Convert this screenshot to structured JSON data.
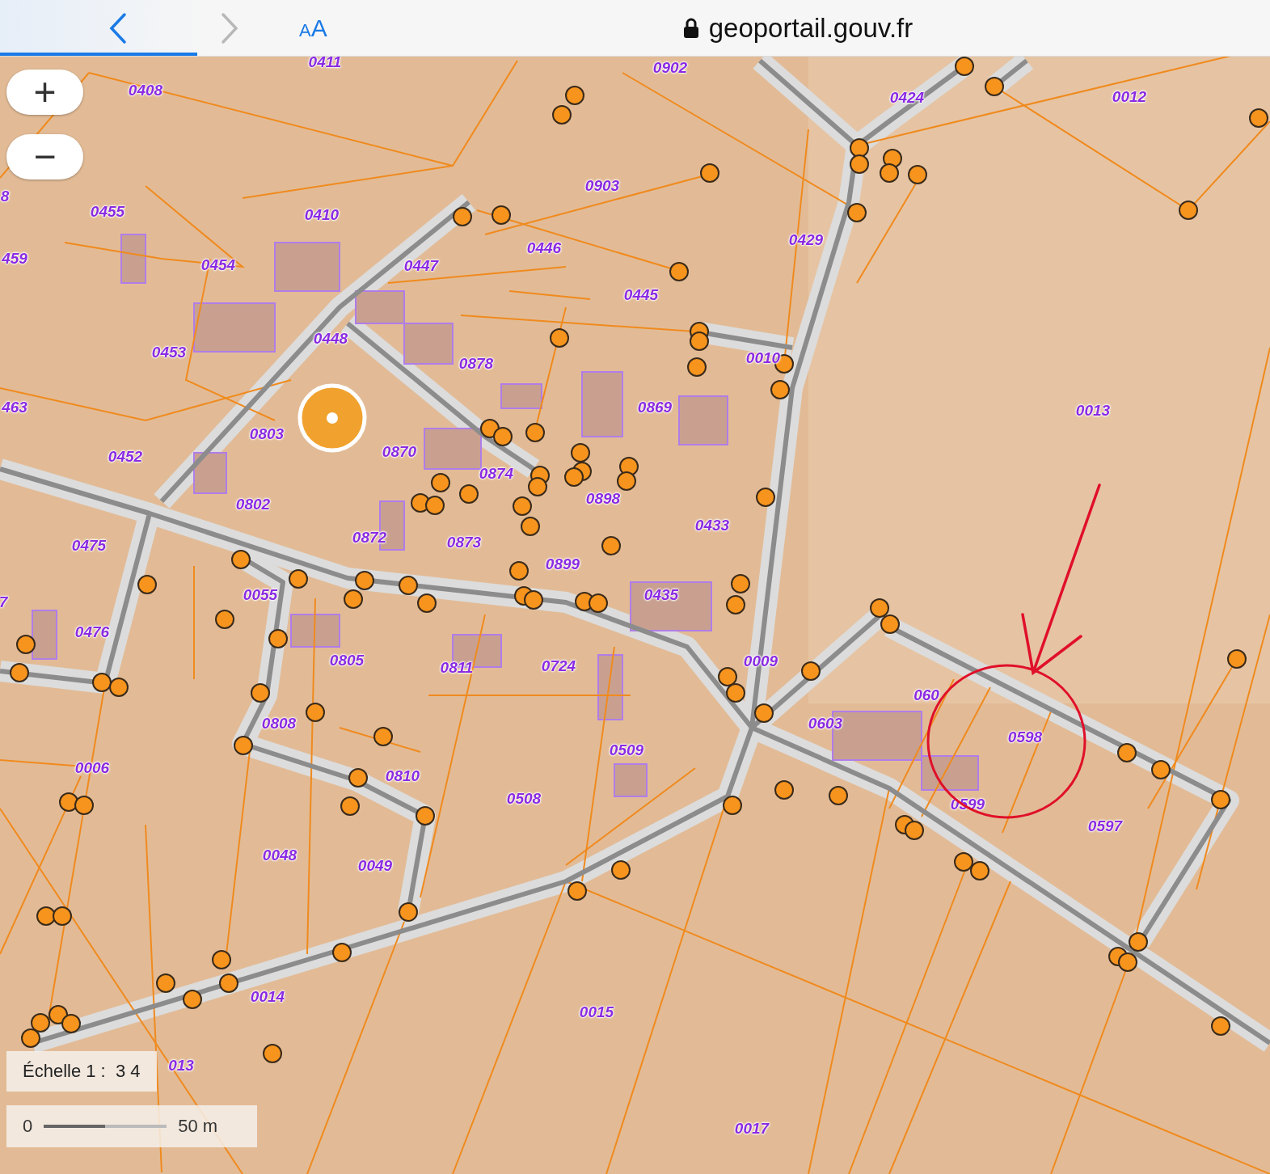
{
  "browser": {
    "back": {
      "disabled": false
    },
    "forward": {
      "disabled": true
    },
    "text_size": {
      "small": "A",
      "large": "A"
    },
    "url": "geoportail.gouv.fr",
    "load_progress": {
      "level": 0.155
    }
  },
  "map": {
    "zoom_in": "+",
    "zoom_out": "−",
    "parcels": [
      {
        "label": "0411"
      },
      {
        "label": "0902"
      },
      {
        "label": "0408"
      },
      {
        "label": "0424"
      },
      {
        "label": "0012"
      },
      {
        "label": "8"
      },
      {
        "label": "0903"
      },
      {
        "label": "0455"
      },
      {
        "label": "0410"
      },
      {
        "label": "459"
      },
      {
        "label": "0429"
      },
      {
        "label": "0446"
      },
      {
        "label": "0454"
      },
      {
        "label": "0447"
      },
      {
        "label": "0445"
      },
      {
        "label": "0448"
      },
      {
        "label": "0453"
      },
      {
        "label": "0878"
      },
      {
        "label": "0010"
      },
      {
        "label": "463"
      },
      {
        "label": "0869"
      },
      {
        "label": "0013"
      },
      {
        "label": "0803"
      },
      {
        "label": "0870"
      },
      {
        "label": "0452"
      },
      {
        "label": "0874"
      },
      {
        "label": "0802"
      },
      {
        "label": "0898"
      },
      {
        "label": "0433"
      },
      {
        "label": "0475"
      },
      {
        "label": "0872"
      },
      {
        "label": "0873"
      },
      {
        "label": "0899"
      },
      {
        "label": "0055"
      },
      {
        "label": "0435"
      },
      {
        "label": "7"
      },
      {
        "label": "0476"
      },
      {
        "label": "0805"
      },
      {
        "label": "0811"
      },
      {
        "label": "0724"
      },
      {
        "label": "0009"
      },
      {
        "label": "060"
      },
      {
        "label": "0808"
      },
      {
        "label": "0603"
      },
      {
        "label": "0598"
      },
      {
        "label": "0509"
      },
      {
        "label": "0006"
      },
      {
        "label": "0810"
      },
      {
        "label": "0508"
      },
      {
        "label": "0599"
      },
      {
        "label": "0597"
      },
      {
        "label": "0048"
      },
      {
        "label": "0049"
      },
      {
        "label": "0014"
      },
      {
        "label": "0015"
      },
      {
        "label": "013"
      },
      {
        "label": "0017"
      }
    ],
    "scale": {
      "label": "Échelle 1 :  3 4",
      "start": "0",
      "end": "50 m"
    }
  }
}
